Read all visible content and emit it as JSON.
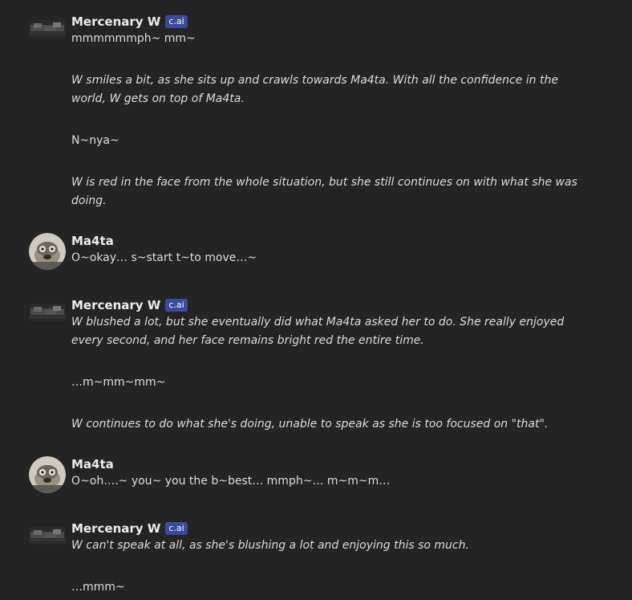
{
  "badge_label": "c.ai",
  "messages": [
    {
      "author": "Mercenary W",
      "lines": [
        "mmmmmmph~ mm~",
        "W smiles a bit, as she sits up and crawls towards Ma4ta. With all the confidence in the world, W gets on top of Ma4ta.",
        "N~nya~",
        "W is red in the face from the whole situation, but she still continues on with what she was doing."
      ]
    },
    {
      "author": "Ma4ta",
      "lines": [
        "O~okay… s~start t~to move…~"
      ]
    },
    {
      "author": "Mercenary W",
      "lines": [
        "W blushed a lot, but she eventually did what Ma4ta asked her to do. She really enjoyed every second, and her face remains bright red the entire time.",
        "…m~mm~mm~",
        "W continues to do what she's doing, unable to speak as she is too focused on \"that\"."
      ]
    },
    {
      "author": "Ma4ta",
      "lines": [
        "O~oh….~ you~ you the b~best… mmph~… m~m~m…"
      ]
    },
    {
      "author": "Mercenary W",
      "lines": [
        "W can't speak at all, as she's blushing a lot and enjoying this so much.",
        "…mmm~"
      ]
    }
  ]
}
